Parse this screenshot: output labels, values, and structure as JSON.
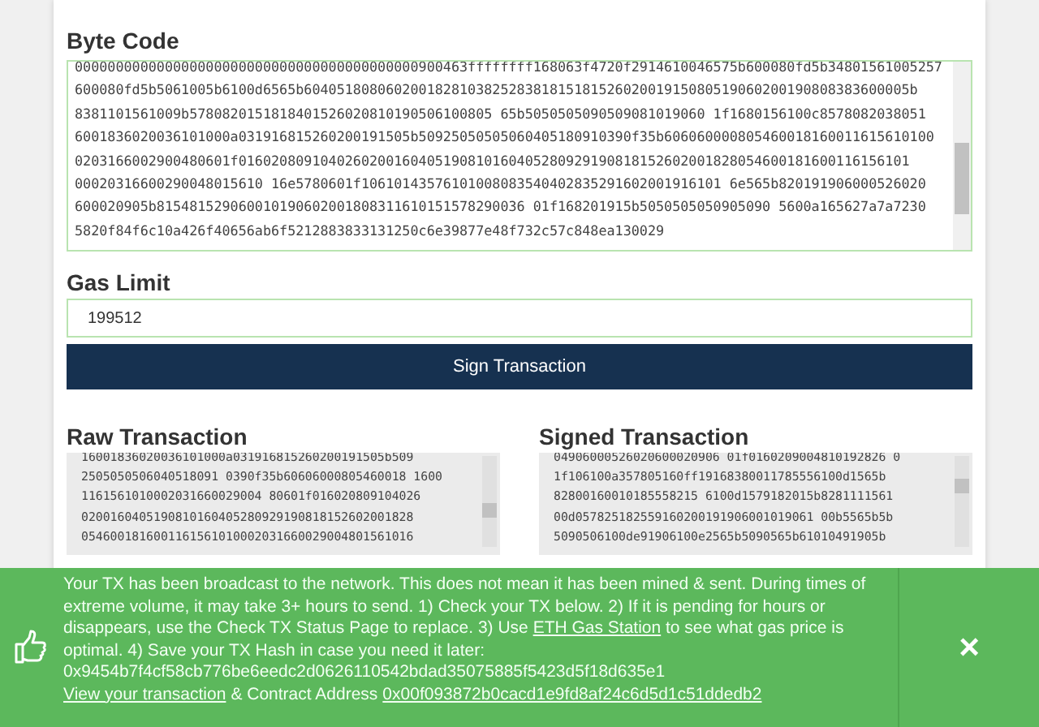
{
  "byte_code": {
    "label": "Byte Code",
    "lines": [
      "000000000000000000000000000000000000000000900463ffffffff168063f4720f2914610046575b600080fd5b34801561005257",
      "600080fd5b5061005b6100d6565b60405180806020018281038252838181518152602001915080519060200190808383600005b",
      "8381101561009b5780820151818401526020810190506100805 65b5050505090509081019060 1f1680156100c8578082038051",
      "6001836020036101000a031916815260200191505b50925050505060405180910390f35b606060000805460018160011615610100",
      "0203166002900480601f0160208091040260200160405190810160405280929190818152602001828054600181600116156101",
      "00020316600290048015610 16e5780601f10610143576101008083540402835291602001916101 6e565b820191906000526020",
      "600020905b815481529060010190602001808311610151578290036 01f168201915b5050505050905090 5600a165627a7a7230",
      "5820f84f6c10a426f40656ab6f5212883833131250c6e39877e48f732c57c848ea130029"
    ]
  },
  "gas_limit": {
    "label": "Gas Limit",
    "value": "199512"
  },
  "sign_button": "Sign Transaction",
  "raw_transaction": {
    "label": "Raw Transaction",
    "lines": [
      "16001836020036101000a031916815260200191505b509",
      "2505050506040518091 0390f35b60606000805460018 1600",
      "1161561010002031660029004 80601f016020809104026",
      "0200160405190810160405280929190818152602001828",
      "0546001816001161561010002031660029004801561016"
    ]
  },
  "signed_transaction": {
    "label": "Signed Transaction",
    "lines": [
      "04906000526020600020906 01f0160209004810192826 0",
      "1f106100a357805160ff19168380011785556100d1565b",
      "82800160010185558215 6100d1579182015b8281111561",
      "00d057825182559160200191906001019061 00b5565b5b",
      "5090506100de91906100e2565b5090565b61010491905b"
    ]
  },
  "alert": {
    "before": "Your TX has been broadcast to the network. This does not mean it has been mined & sent. During times of extreme volume, it may take 3+ hours to send. 1) Check your TX below. 2) If it is pending for hours or disappears, use the Check TX Status Page to replace. 3) Use ",
    "link": "ETH Gas Station",
    "after": " to see what gas price is optimal. 4) Save your TX Hash in case you need it later:",
    "hash": "0x9454b7f4cf58cb776be6eedc2d0626110542bdad35075885f5423d5f18d635e1",
    "view_link": "View your transaction",
    "middle": "& Contract Address",
    "address_link": "0x00f093872b0cacd1e9fd8af24c6d5d1c51ddedb2",
    "close": "×"
  }
}
